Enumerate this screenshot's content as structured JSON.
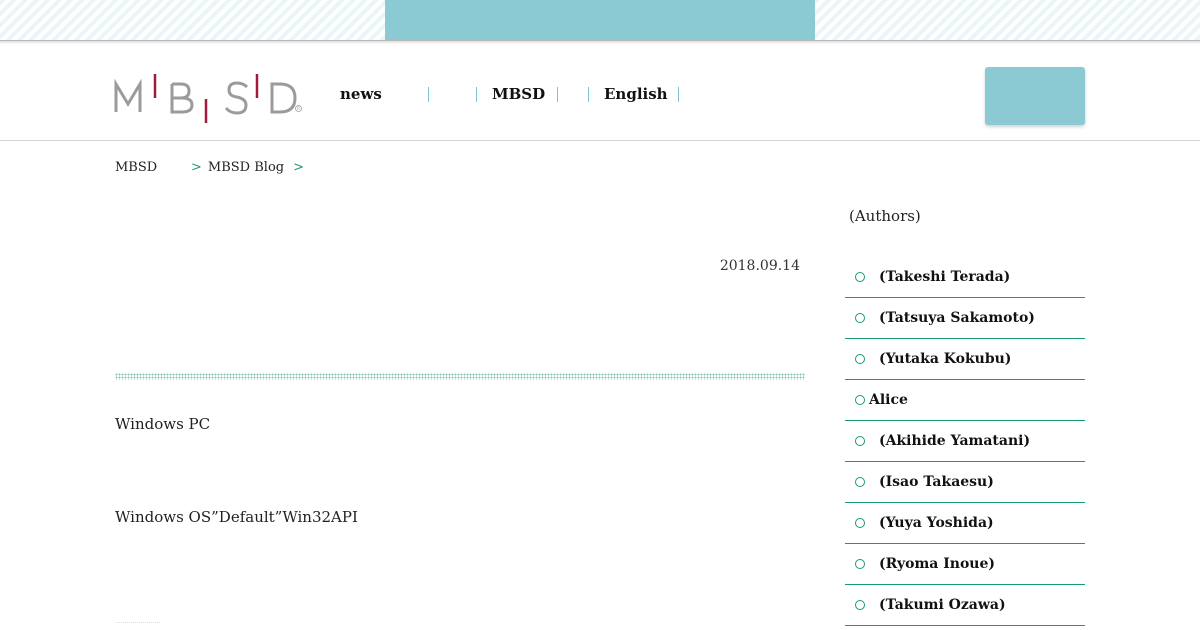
{
  "header": {
    "nav": [
      {
        "label": "news"
      },
      {
        "label": ""
      },
      {
        "label": "MBSD"
      },
      {
        "label": "English"
      }
    ]
  },
  "breadcrumb": {
    "home": "MBSD",
    "sep1": ">",
    "blog": "MBSD Blog",
    "sep2": ">"
  },
  "article": {
    "date": "2018.09.14",
    "paragraphs": [
      "Windows PC",
      "Windows OS”Default”Win32API"
    ]
  },
  "sidebar": {
    "title": "(Authors)",
    "authors": [
      "(Takeshi Terada)",
      "(Tatsuya Sakamoto)",
      "(Yutaka Kokubu)",
      "Alice",
      "(Akihide Yamatani)",
      "(Isao Takaesu)",
      "(Yuya Yoshida)",
      "(Ryoma Inoue)",
      "(Takumi Ozawa)"
    ]
  },
  "colors": {
    "accent_teal": "#8ccad3",
    "accent_green": "#169b73",
    "logo_gray": "#9b9b9b",
    "logo_red": "#a01a3c"
  }
}
